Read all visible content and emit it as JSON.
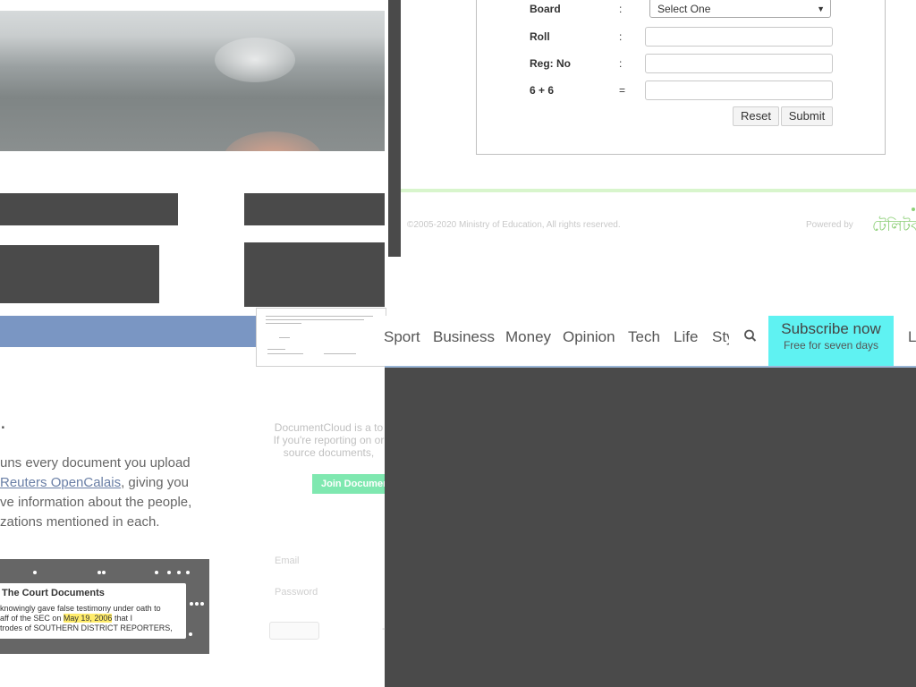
{
  "result_form": {
    "board_label": "Board",
    "board_sep": ":",
    "board_value": "Select One",
    "roll_label": "Roll",
    "roll_sep": ":",
    "reg_label": "Reg: No",
    "reg_sep": ":",
    "captcha_label": "6 + 6",
    "captcha_sep": "=",
    "reset_label": "Reset",
    "submit_label": "Submit"
  },
  "footer": {
    "copyright": "©2005-2020 Ministry of Education, All rights reserved.",
    "powered_by": "Powered by",
    "logo_text": "টেলিটক"
  },
  "news_nav": {
    "items": [
      "Sport",
      "Business",
      "Money",
      "Opinion",
      "Tech",
      "Life",
      "Sty"
    ],
    "subscribe_title": "Subscribe now",
    "subscribe_sub": "Free for seven days",
    "trailing": "L"
  },
  "documentcloud": {
    "heading": "s.",
    "body_lines": [
      "uns every document you upload",
      "",
      "ve information about the people,",
      "zations mentioned in each."
    ],
    "body_link": "Reuters OpenCalais",
    "body_line2_suffix": ", giving you",
    "intro_lines": [
      "DocumentCloud is a to",
      "If you're reporting on or",
      "source documents,"
    ],
    "join_label": "Join Documen",
    "email_label": "Email",
    "password_label": "Password",
    "dash": "-"
  },
  "doc_preview": {
    "title": "The Court Documents",
    "line1": "knowingly gave false testimony under oath to",
    "line2_pre": "aff of the SEC on ",
    "line2_highlight": "May 19, 2006",
    "line2_post": " that I",
    "line3": "trodes of SOUTHERN DISTRICT REPORTERS,"
  },
  "colors": {
    "social_bar": "#7a96c3",
    "subscribe_bg": "#5ff2f2",
    "dark_block": "#4a4a4a",
    "footer_line": "#d8f5cc",
    "highlight": "#ffec6b"
  }
}
